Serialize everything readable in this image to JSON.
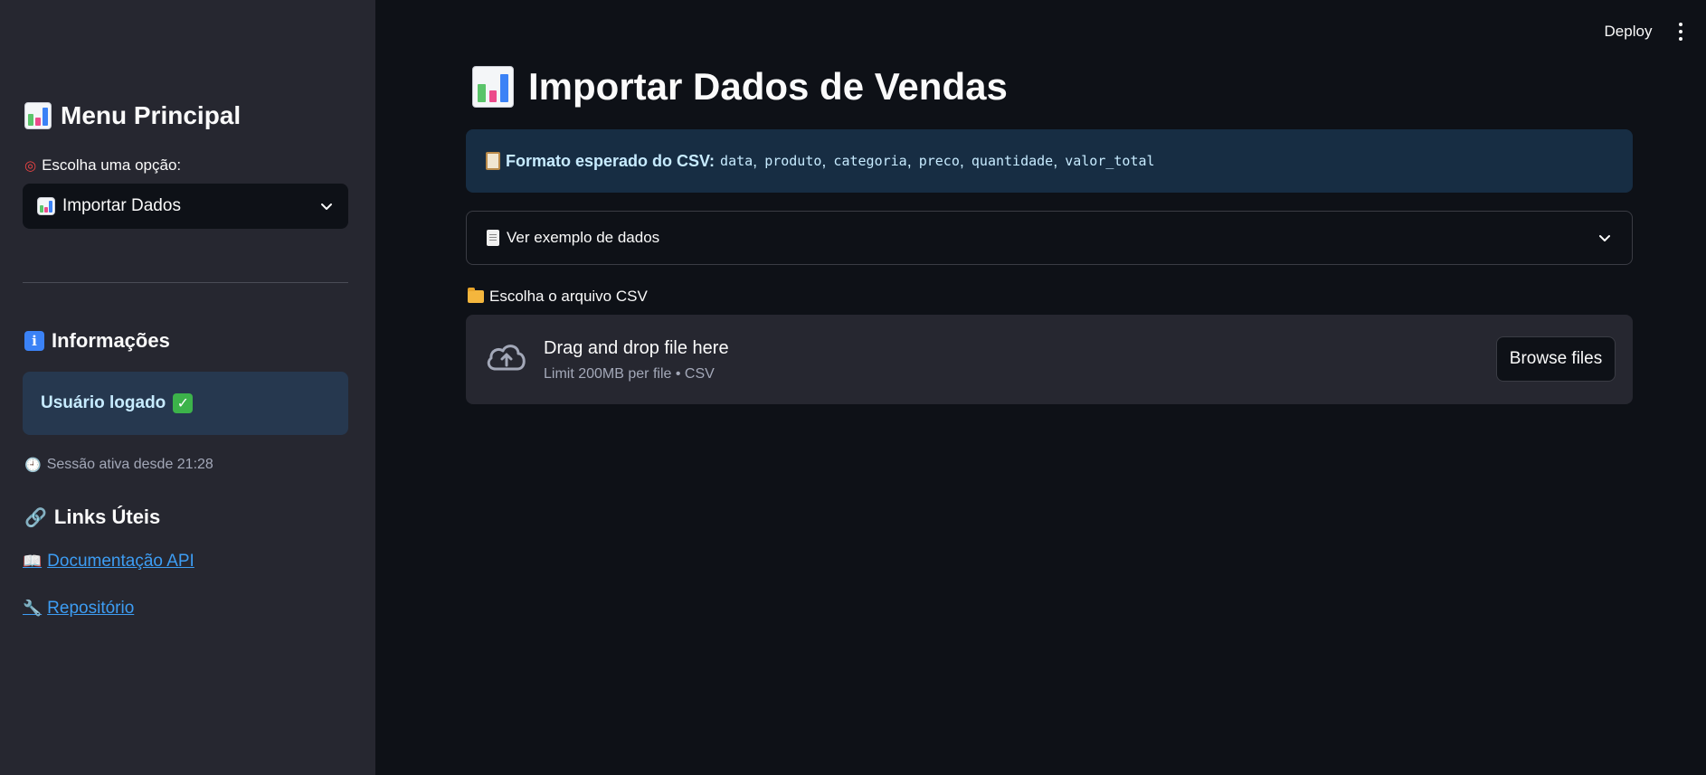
{
  "sidebar": {
    "title": "Menu Principal",
    "select_label": "Escolha uma opção:",
    "select_value": "Importar Dados",
    "info_heading": "Informações",
    "info_status": "Usuário logado",
    "session_text": "Sessão ativa desde 21:28",
    "links_heading": "Links Úteis",
    "links": [
      {
        "label": "Documentação API",
        "icon": "book-icon"
      },
      {
        "label": "Repositório",
        "icon": "wrench-icon"
      }
    ]
  },
  "header": {
    "deploy_label": "Deploy"
  },
  "main": {
    "title": "Importar Dados de Vendas",
    "csv_info": {
      "label": "Formato esperado do CSV:",
      "columns": [
        "data",
        "produto",
        "categoria",
        "preco",
        "quantidade",
        "valor_total"
      ]
    },
    "expander_label": "Ver exemplo de dados",
    "uploader": {
      "label": "Escolha o arquivo CSV",
      "drop_text": "Drag and drop file here",
      "limit_text": "Limit 200MB per file • CSV",
      "browse_label": "Browse files"
    }
  },
  "colors": {
    "background": "#0e1117",
    "sidebar": "#262730",
    "info_box": "#26384f",
    "csv_info": "#172d43",
    "link": "#3d9df3"
  }
}
